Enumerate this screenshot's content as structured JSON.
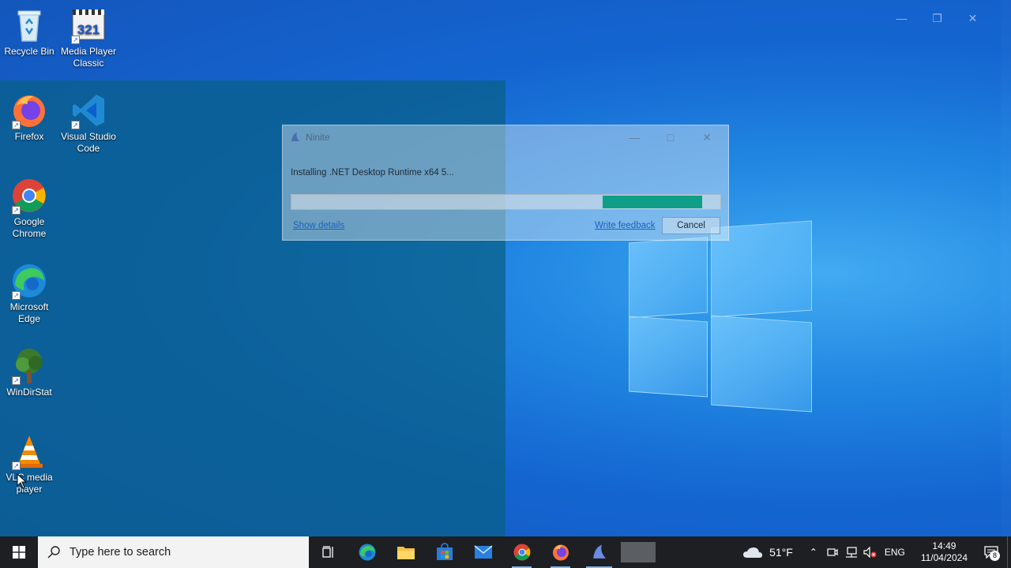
{
  "desktop": {
    "icons": [
      {
        "label": "Recycle Bin",
        "icon": "recycle-bin-icon"
      },
      {
        "label": "Media Player Classic",
        "icon": "media-player-classic-icon"
      },
      {
        "label": "Firefox",
        "icon": "firefox-icon"
      },
      {
        "label": "Visual Studio Code",
        "icon": "vscode-icon"
      },
      {
        "label": "Google Chrome",
        "icon": "chrome-icon"
      },
      {
        "label": "Microsoft Edge",
        "icon": "edge-icon"
      },
      {
        "label": "WinDirStat",
        "icon": "windirstat-icon"
      },
      {
        "label": "VLC media player",
        "icon": "vlc-icon"
      }
    ],
    "mpc_number": "321"
  },
  "ninite": {
    "title": "Ninite",
    "status": "Installing .NET Desktop Runtime x64 5...",
    "progress": {
      "segment_start": 0.725,
      "segment_end": 0.958
    },
    "show_details": "Show details",
    "write_feedback": "Write feedback",
    "cancel": "Cancel"
  },
  "taskbar": {
    "search_placeholder": "Type here to search",
    "apps": [
      "task-view",
      "microsoft-edge",
      "file-explorer",
      "microsoft-store",
      "mail",
      "google-chrome",
      "firefox",
      "ninite"
    ],
    "weather": "51°F",
    "language": "ENG",
    "time": "14:49",
    "date": "11/04/2024",
    "notification_count": "8"
  },
  "colors": {
    "progress_fill": "#0f9f86",
    "link": "#1f5fb8",
    "taskbar": "#1d1f23"
  }
}
